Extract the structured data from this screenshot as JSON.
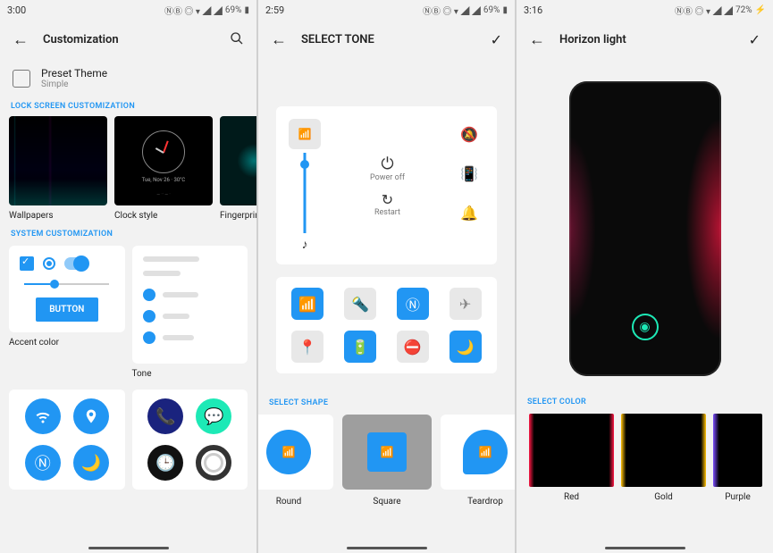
{
  "screens": [
    {
      "status": {
        "time": "3:00",
        "battery": "69%",
        "icons": "ⓃⒷ ◎ ▾ ◢ ◢"
      },
      "header": {
        "title": "Customization",
        "action": "search"
      },
      "preset": {
        "title": "Preset Theme",
        "subtitle": "Simple"
      },
      "sections": {
        "lock": {
          "label": "LOCK SCREEN CUSTOMIZATION",
          "items": [
            {
              "label": "Wallpapers"
            },
            {
              "label": "Clock style"
            },
            {
              "label": "Fingerprint"
            }
          ]
        },
        "system": {
          "label": "SYSTEM CUSTOMIZATION",
          "items": [
            {
              "label": "Accent color",
              "button": "BUTTON"
            },
            {
              "label": "Tone"
            }
          ]
        }
      }
    },
    {
      "status": {
        "time": "2:59",
        "battery": "69%",
        "icons": "ⓃⒷ ◎ ▾ ◢ ◢"
      },
      "header": {
        "title": "SELECT TONE",
        "action": "check"
      },
      "power": {
        "off": "Power off",
        "restart": "Restart"
      },
      "qs_tiles": [
        {
          "icon": "wifi",
          "on": true
        },
        {
          "icon": "flashlight",
          "on": false
        },
        {
          "icon": "nfc",
          "on": true
        },
        {
          "icon": "airplane",
          "on": false
        },
        {
          "icon": "location",
          "on": false
        },
        {
          "icon": "battery",
          "on": true
        },
        {
          "icon": "dnd",
          "on": false
        },
        {
          "icon": "night",
          "on": true
        }
      ],
      "shape": {
        "label": "SELECT SHAPE",
        "items": [
          {
            "label": "Round",
            "selected": false
          },
          {
            "label": "Square",
            "selected": true
          },
          {
            "label": "Teardrop",
            "selected": false
          }
        ]
      }
    },
    {
      "status": {
        "time": "3:16",
        "battery": "72%",
        "icons": "ⓃⒷ ◎ ▾ ◢ ◢",
        "charging": true
      },
      "header": {
        "title": "Horizon light",
        "action": "check"
      },
      "color": {
        "label": "SELECT COLOR",
        "items": [
          {
            "label": "Red"
          },
          {
            "label": "Gold"
          },
          {
            "label": "Purple"
          }
        ]
      }
    }
  ]
}
